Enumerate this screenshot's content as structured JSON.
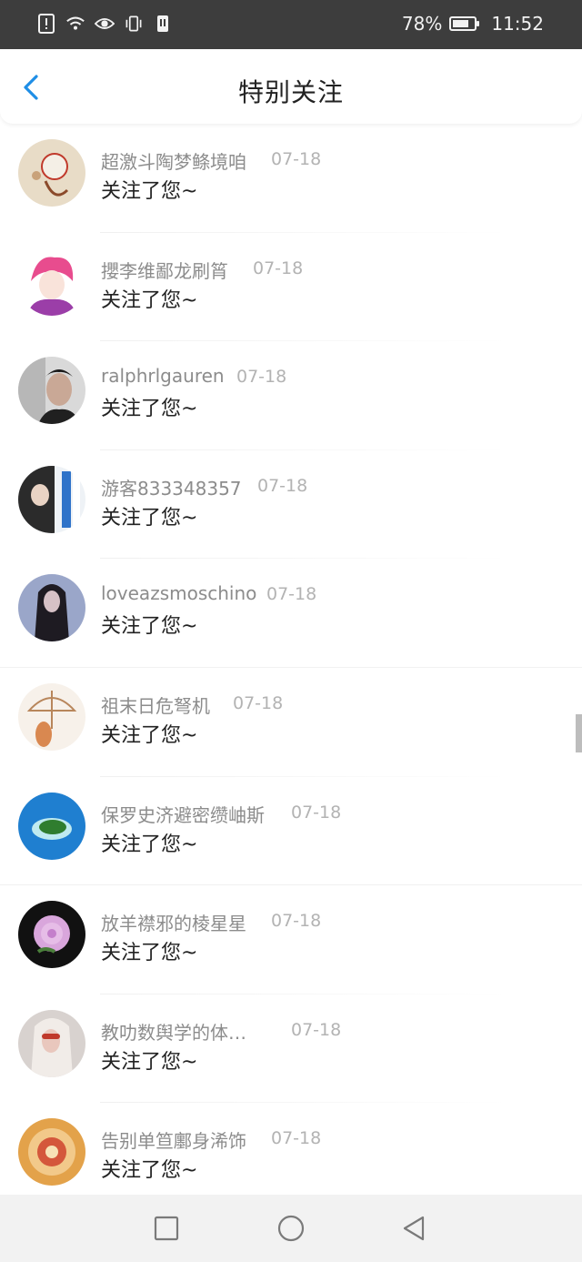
{
  "status_bar": {
    "battery": "78%",
    "battery_level": 0.78,
    "time": "11:52",
    "icons": [
      "alert-icon",
      "wifi-icon",
      "eye-icon",
      "vibrate-icon",
      "sim-icon"
    ]
  },
  "header": {
    "title": "特别关注",
    "back_icon": "chevron-left-icon"
  },
  "list": {
    "items": [
      {
        "name": "超激斗陶梦鲦境咱",
        "date": "07-18",
        "message": "关注了您~"
      },
      {
        "name": "攖李维鄙龙刷筲",
        "date": "07-18",
        "message": "关注了您~"
      },
      {
        "name": "ralphrlgauren",
        "date": "07-18",
        "message": "关注了您~"
      },
      {
        "name": "游客833348357",
        "date": "07-18",
        "message": "关注了您~"
      },
      {
        "name": "loveazsmoschino",
        "date": "07-18",
        "message": "关注了您~"
      },
      {
        "name": "祖末日危弩机",
        "date": "07-18",
        "message": "关注了您~"
      },
      {
        "name": "保罗史济避密缵岫斯",
        "date": "07-18",
        "message": "关注了您~"
      },
      {
        "name": "放羊襟邪的棱星星",
        "date": "07-18",
        "message": "关注了您~"
      },
      {
        "name": "教叻数舆学的体…",
        "date": "07-18",
        "message": "关注了您~"
      },
      {
        "name": "告别单笪鄽身浠饰",
        "date": "07-18",
        "message": "关注了您~"
      }
    ]
  },
  "navbar": {
    "buttons": [
      "recent-apps-icon",
      "home-icon",
      "back-triangle-icon"
    ]
  }
}
